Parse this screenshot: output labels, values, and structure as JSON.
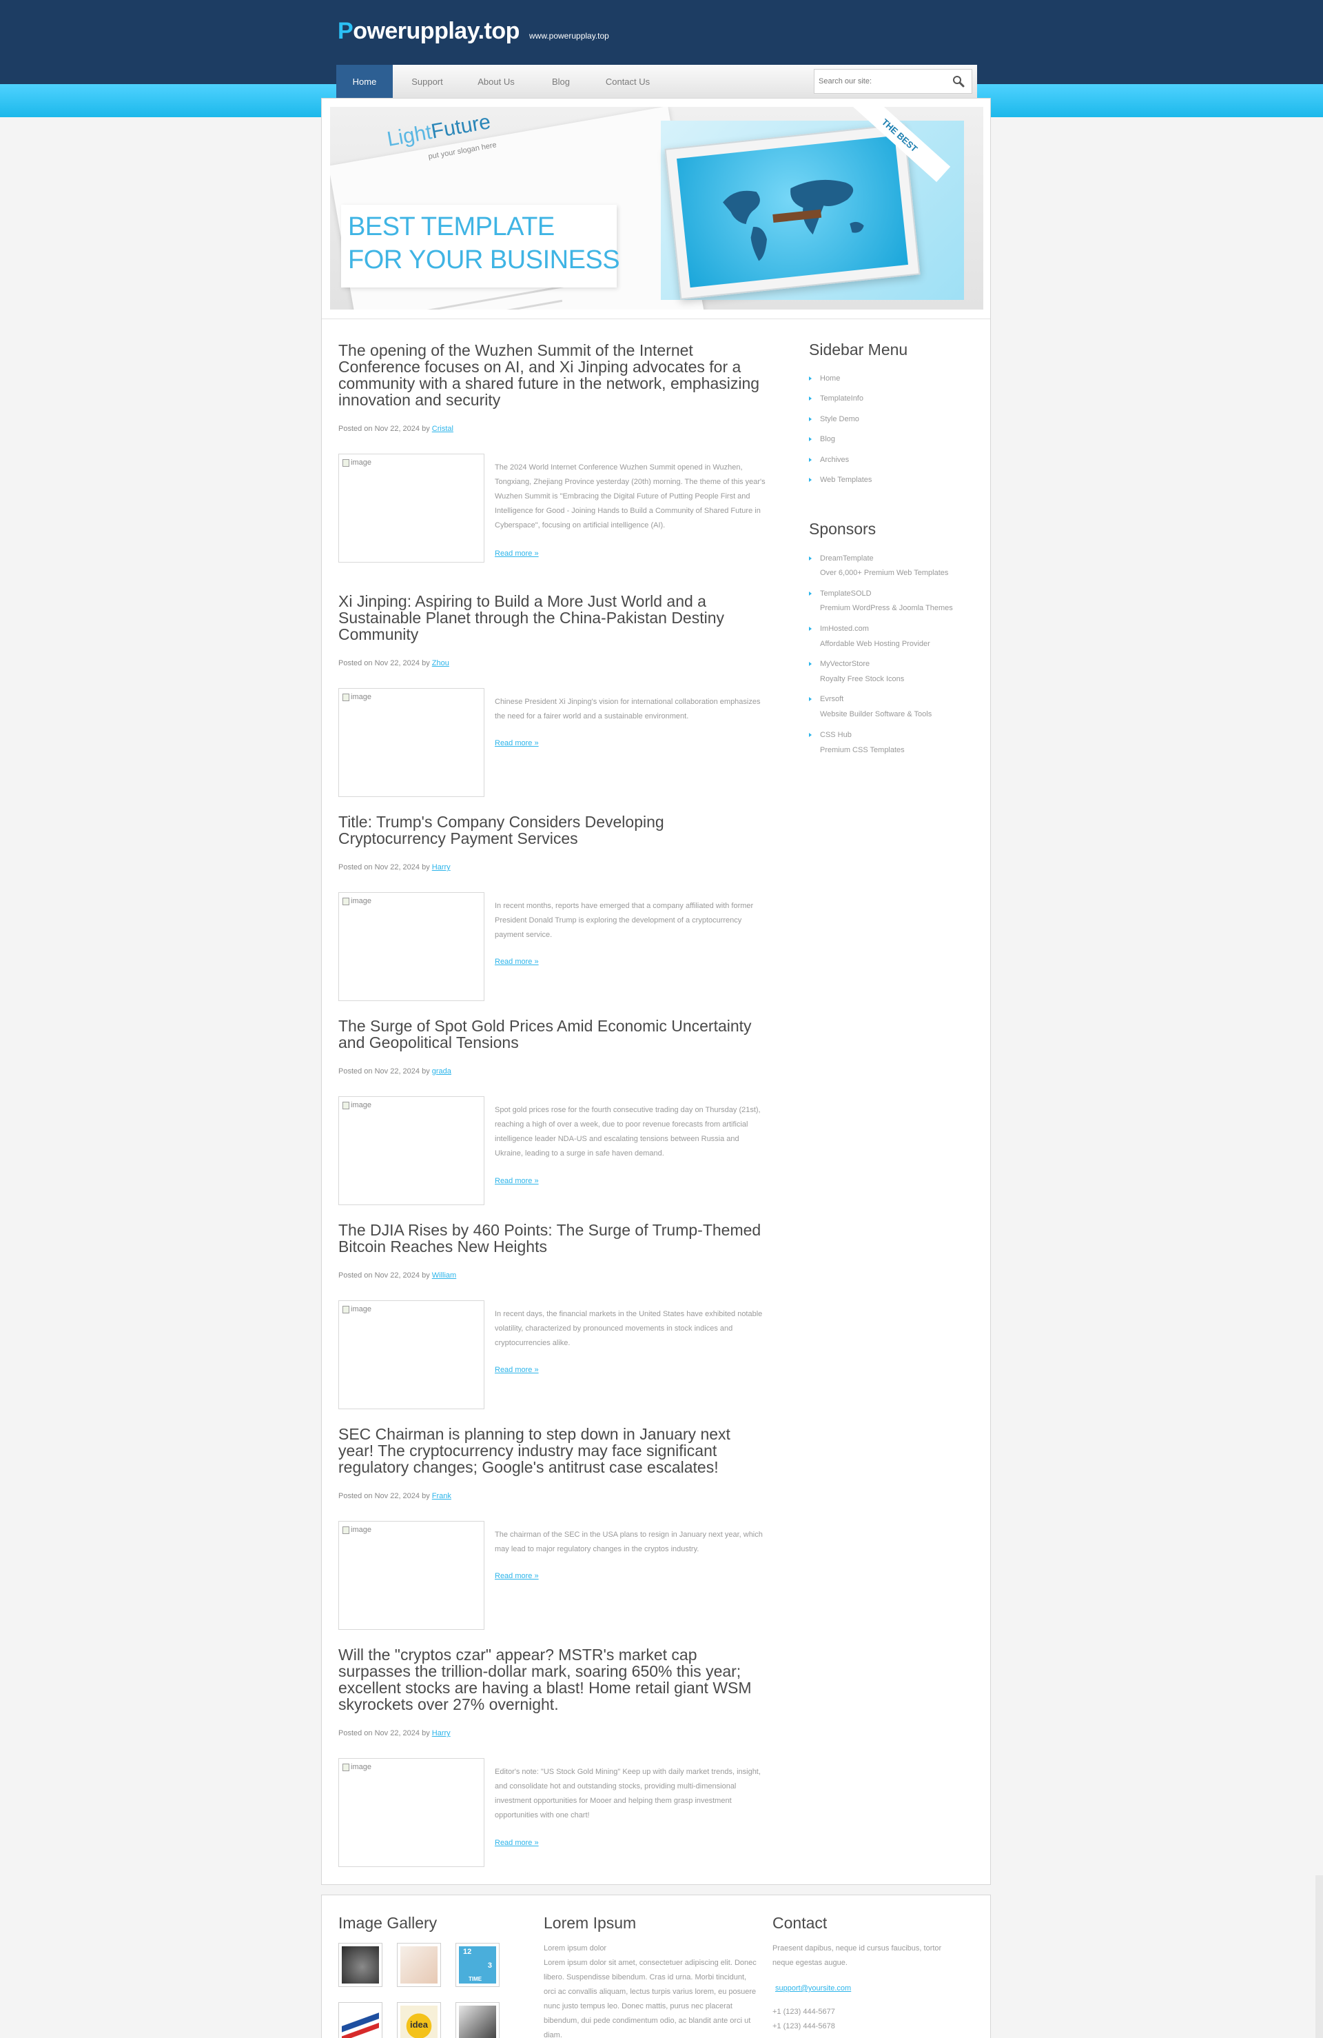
{
  "header": {
    "logo_first_letter": "P",
    "logo_rest": "owerupplay.top",
    "slogan": "www.powerupplay.top"
  },
  "nav": {
    "items": [
      "Home",
      "Support",
      "About Us",
      "Blog",
      "Contact Us"
    ],
    "active": "Home"
  },
  "search": {
    "placeholder": "Search our site:"
  },
  "banner": {
    "brand_light": "Light",
    "brand_bold": "Future",
    "brand_slogan": "put your slogan here",
    "headline_1": "BEST TEMPLATE",
    "headline_2": "FOR YOUR BUSINESS",
    "ribbon": "THE BEST"
  },
  "posts": [
    {
      "title": "The opening of the Wuzhen Summit of the Internet Conference focuses on AI, and Xi Jinping advocates for a community with a shared future in the network, emphasizing innovation and security",
      "meta_prefix": "Posted on Nov 22, 2024 by ",
      "author": "Cristal",
      "image_alt": "image",
      "excerpt": "The 2024 World Internet Conference Wuzhen Summit opened in Wuzhen, Tongxiang, Zhejiang Province yesterday (20th) morning. The theme of this year's Wuzhen Summit is \"Embracing the Digital Future of Putting People First and Intelligence for Good - Joining Hands to Build a Community of Shared Future in Cyberspace\", focusing on artificial intelligence (AI).",
      "read_more": "Read more »"
    },
    {
      "title": "Xi Jinping: Aspiring to Build a More Just World and a Sustainable Planet through the China-Pakistan Destiny Community",
      "meta_prefix": "Posted on Nov 22, 2024 by ",
      "author": "Zhou",
      "image_alt": "image",
      "excerpt": "Chinese President Xi Jinping's vision for international collaboration emphasizes the need for a fairer world and a sustainable environment.",
      "read_more": "Read more »"
    },
    {
      "title": "Title: Trump's Company Considers Developing Cryptocurrency Payment Services",
      "meta_prefix": "Posted on Nov 22, 2024 by ",
      "author": "Harry",
      "image_alt": "image",
      "excerpt": "In recent months, reports have emerged that a company affiliated with former President Donald Trump is exploring the development of a cryptocurrency payment service.",
      "read_more": "Read more »"
    },
    {
      "title": "The Surge of Spot Gold Prices Amid Economic Uncertainty and Geopolitical Tensions",
      "meta_prefix": "Posted on Nov 22, 2024 by ",
      "author": "grada",
      "image_alt": "image",
      "excerpt": "Spot gold prices rose for the fourth consecutive trading day on Thursday (21st), reaching a high of over a week, due to poor revenue forecasts from artificial intelligence leader NDA-US and escalating tensions between Russia and Ukraine, leading to a surge in safe haven demand.",
      "read_more": "Read more »"
    },
    {
      "title": "The DJIA Rises by 460 Points: The Surge of Trump-Themed Bitcoin Reaches New Heights",
      "meta_prefix": "Posted on Nov 22, 2024 by ",
      "author": "William",
      "image_alt": "image",
      "excerpt": "In recent days, the financial markets in the United States have exhibited notable volatility, characterized by pronounced movements in stock indices and cryptocurrencies alike.",
      "read_more": "Read more »"
    },
    {
      "title": "SEC Chairman is planning to step down in January next year! The cryptocurrency industry may face significant regulatory changes; Google's antitrust case escalates!",
      "meta_prefix": "Posted on Nov 22, 2024 by ",
      "author": "Frank",
      "image_alt": "image",
      "excerpt": "The chairman of the SEC in the USA plans to resign in January next year, which may lead to major regulatory changes in the cryptos industry.",
      "read_more": "Read more »"
    },
    {
      "title": "Will the \"cryptos czar\" appear? MSTR's market cap surpasses the trillion-dollar mark, soaring 650% this year; excellent stocks are having a blast! Home retail giant WSM skyrockets over 27% overnight.",
      "meta_prefix": "Posted on Nov 22, 2024 by ",
      "author": "Harry",
      "image_alt": "image",
      "excerpt": "Editor's note: \"US Stock Gold Mining\" Keep up with daily market trends, insight, and consolidate hot and outstanding stocks, providing multi-dimensional investment opportunities for Mooer and helping them grasp investment opportunities with one chart!",
      "read_more": "Read more »"
    }
  ],
  "sidebar": {
    "menu_title": "Sidebar Menu",
    "menu_items": [
      "Home",
      "TemplateInfo",
      "Style Demo",
      "Blog",
      "Archives",
      "Web Templates"
    ],
    "sponsors_title": "Sponsors",
    "sponsors": [
      {
        "name": "DreamTemplate",
        "desc": "Over 6,000+ Premium Web Templates"
      },
      {
        "name": "TemplateSOLD",
        "desc": "Premium WordPress & Joomla Themes"
      },
      {
        "name": "ImHosted.com",
        "desc": "Affordable Web Hosting Provider"
      },
      {
        "name": "MyVectorStore",
        "desc": "Royalty Free Stock Icons"
      },
      {
        "name": "Evrsoft",
        "desc": "Website Builder Software & Tools"
      },
      {
        "name": "CSS Hub",
        "desc": "Premium CSS Templates"
      }
    ]
  },
  "footer": {
    "gallery_title": "Image Gallery",
    "gallery_thumb_texts": [
      "12",
      "3",
      "TIME",
      "idea"
    ],
    "lorem_title": "Lorem Ipsum",
    "lorem_heading": "Lorem ipsum dolor",
    "lorem_text": "Lorem ipsum dolor sit amet, consectetuer adipiscing elit. Donec libero. Suspendisse bibendum. Cras id urna. Morbi tincidunt, orci ac convallis aliquam, lectus turpis varius lorem, eu posuere nunc justo tempus leo. Donec mattis, purus nec placerat bibendum, dui pede condimentum odio, ac blandit ante orci ut diam.",
    "contact_title": "Contact",
    "contact_text": "Praesent dapibus, neque id cursus faucibus, tortor neque egestas augue.",
    "contact_email": "support@yoursite.com",
    "contact_phone_1": "+1 (123) 444-5677",
    "contact_phone_2": "+1 (123) 444-5678"
  },
  "colors": {
    "header_bg": "#1d3d63",
    "accent_cyan": "#2bb4ea",
    "nav_active": "#2d5f93"
  }
}
